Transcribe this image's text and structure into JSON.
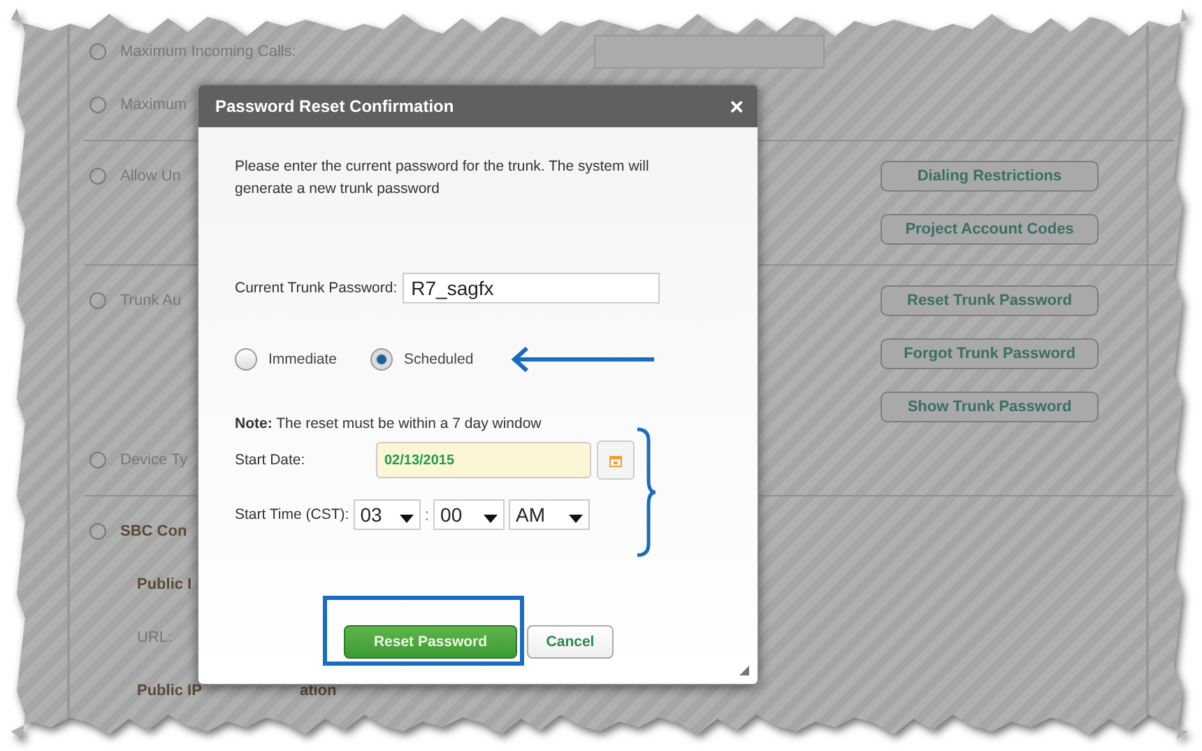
{
  "background": {
    "sections": [
      {
        "rows": [
          {
            "kind": "field",
            "label": "Maximum Incoming Calls:"
          },
          {
            "kind": "help",
            "label": "Maximum"
          }
        ]
      },
      {
        "rows": [
          {
            "kind": "help",
            "label": "Allow Un",
            "button": "Dialing Restrictions"
          },
          {
            "kind": "button",
            "button": "Project Account Codes"
          }
        ]
      },
      {
        "rows": [
          {
            "kind": "help",
            "label": "Trunk Au",
            "button": "Reset Trunk Password"
          },
          {
            "kind": "button",
            "button": "Forgot Trunk Password"
          },
          {
            "kind": "button",
            "button": "Show Trunk Password"
          },
          {
            "kind": "help",
            "label": "Device Ty"
          }
        ]
      },
      {
        "rows": [
          {
            "kind": "help_bold",
            "label": "SBC Con"
          },
          {
            "kind": "sub_bold",
            "label": "Public I"
          },
          {
            "kind": "sub",
            "label": "URL:"
          },
          {
            "kind": "sub_bold",
            "label": "Public IP",
            "tail": "ation"
          }
        ]
      }
    ]
  },
  "dialog": {
    "title": "Password Reset Confirmation",
    "close": "×",
    "intro": "Please enter the current password for the trunk. The system will generate a new trunk password",
    "password": {
      "label": "Current Trunk Password:",
      "value": "R7_sagfx"
    },
    "radios": [
      {
        "label": "Immediate",
        "selected": false
      },
      {
        "label": "Scheduled",
        "selected": true
      }
    ],
    "note": "**Note:** The reset must be within a 7 day window",
    "start_date": {
      "label": "Start Date:",
      "value": "02/13/2015"
    },
    "start_time": {
      "label": "Start Time (CST):",
      "hour": "03",
      "separator": ":",
      "minute": "00",
      "ampm": "AM"
    },
    "buttons": [
      {
        "label": "Reset Password",
        "kind": "primary"
      },
      {
        "label": "Cancel",
        "kind": "secondary"
      }
    ]
  }
}
